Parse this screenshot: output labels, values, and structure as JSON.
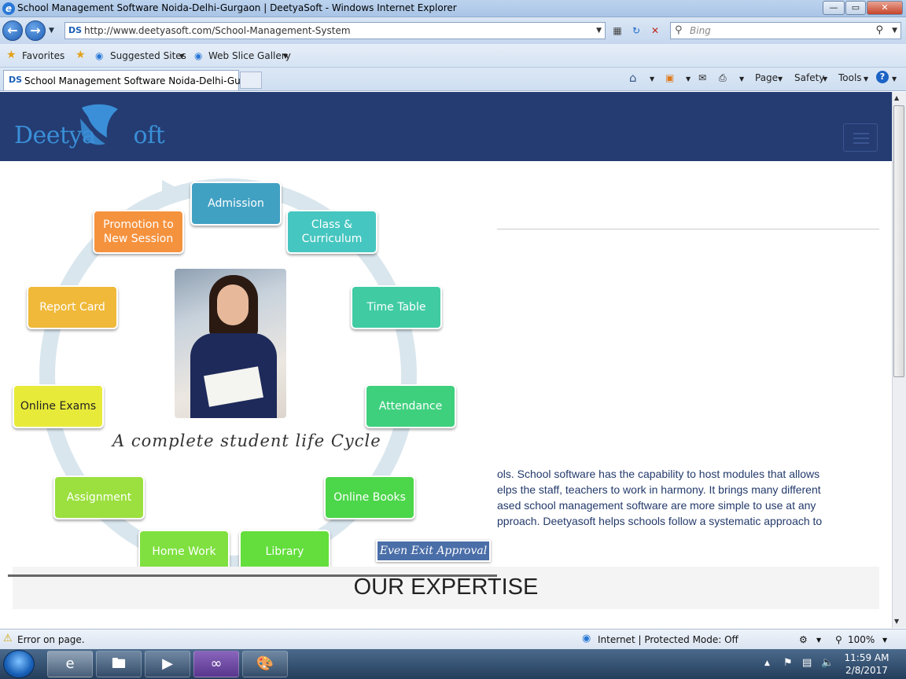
{
  "window": {
    "title": "School Management Software Noida-Delhi-Gurgaon | DeetyaSoft - Windows Internet Explorer",
    "buttons": {
      "minimize": "—",
      "maximize": "▭",
      "close": "✕"
    }
  },
  "addressbar": {
    "url": "http://www.deetyasoft.com/School-Management-System",
    "search_placeholder": "Bing"
  },
  "favorites": {
    "favorites_label": "Favorites",
    "suggested_sites": "Suggested Sites",
    "web_slice_gallery": "Web Slice Gallery"
  },
  "tabs": {
    "active_label": "School Management Software Noida-Delhi-Gurg..."
  },
  "commandbar": {
    "page": "Page",
    "safety": "Safety",
    "tools": "Tools"
  },
  "site": {
    "logo_text": "Deetya",
    "logo_suffix": "oft",
    "cycle_nodes": [
      {
        "label": "Admission",
        "color": "#41a1c3"
      },
      {
        "label": "Class & Curriculum",
        "color": "#46c6c0"
      },
      {
        "label": "Time Table",
        "color": "#40cba3"
      },
      {
        "label": "Attendance",
        "color": "#3fd07e"
      },
      {
        "label": "Online Books",
        "color": "#4cd64a"
      },
      {
        "label": "Library",
        "color": "#63de3c"
      },
      {
        "label": "Home Work",
        "color": "#7fe040"
      },
      {
        "label": "Assignment",
        "color": "#9be03e"
      },
      {
        "label": "Online Exams",
        "color": "#e8ea3a"
      },
      {
        "label": "Report Card",
        "color": "#f0b93a"
      },
      {
        "label": "Promotion to New Session",
        "color": "#f5923e"
      }
    ],
    "cycle_caption": "A complete student life Cycle",
    "approval_badge": "Even Exit Approval",
    "body_lines": [
      "ols. School software has the capability to host modules that allows",
      "elps the staff, teachers to work in harmony. It brings many different",
      "ased school management software are more simple to use at any",
      "pproach. Deetyasoft helps schools follow a systematic approach to"
    ],
    "expertise_heading": "OUR EXPERTISE"
  },
  "statusbar": {
    "error_text": "Error on page.",
    "zone_text": "Internet | Protected Mode: Off",
    "zoom": "100%"
  },
  "taskbar": {
    "time": "11:59 AM",
    "date": "2/8/2017"
  }
}
